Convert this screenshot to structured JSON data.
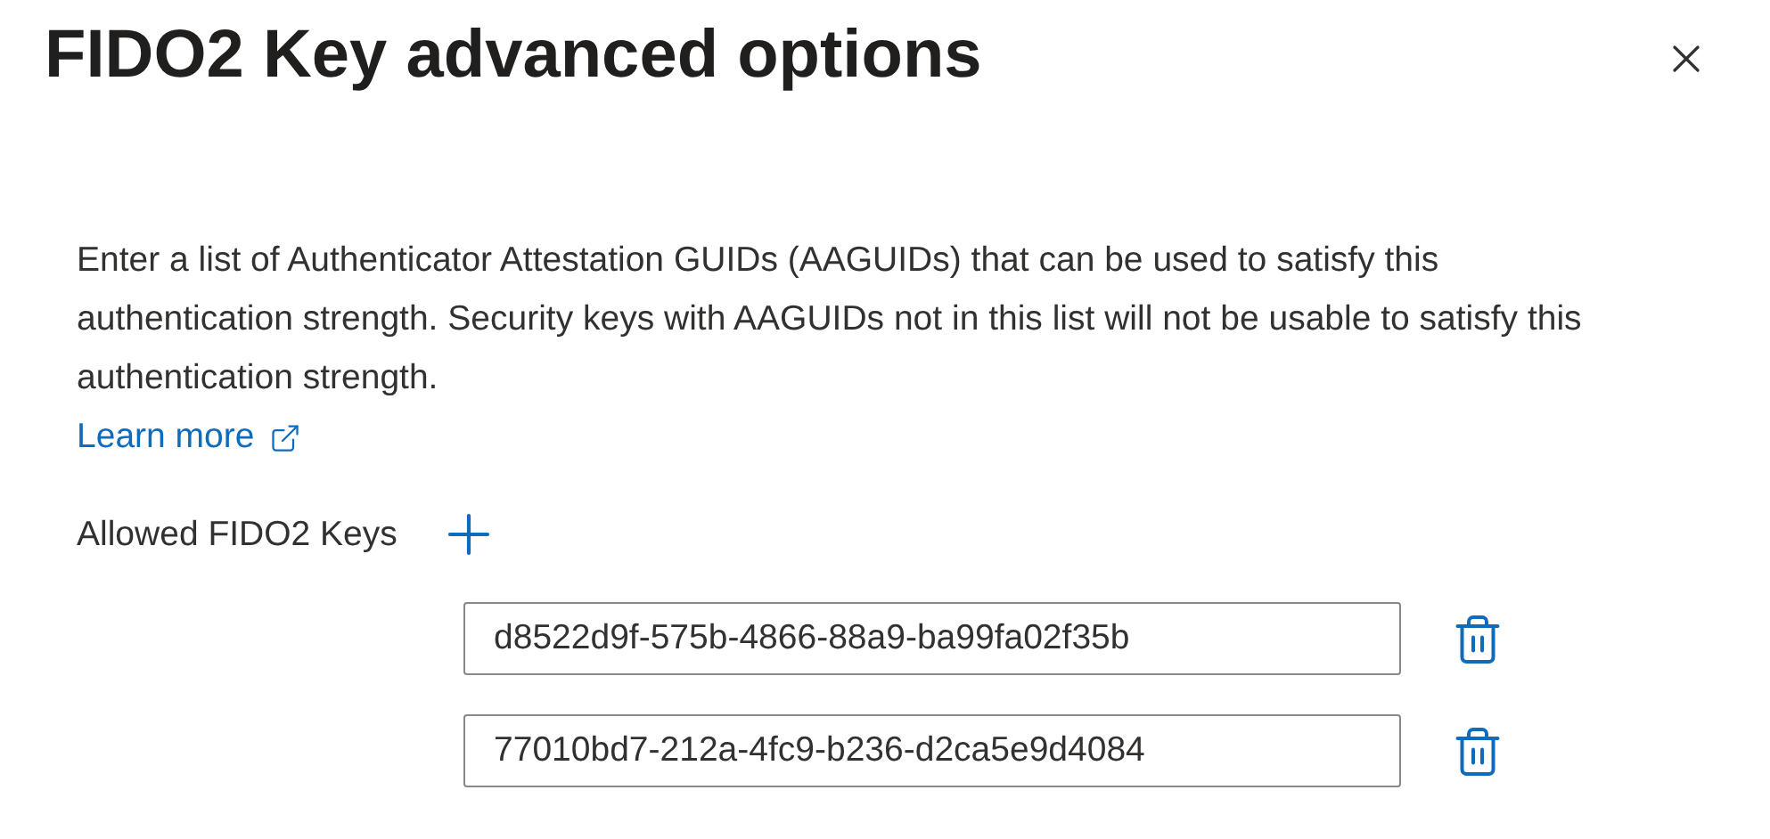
{
  "dialog": {
    "title": "FIDO2 Key advanced options"
  },
  "description": "Enter a list of Authenticator Attestation GUIDs (AAGUIDs) that can be used to satisfy this authentication strength. Security keys with AAGUIDs not in this list will not be usable to satisfy this authentication strength.",
  "learn_more": "Learn more",
  "allowed_keys": {
    "label": "Allowed FIDO2 Keys",
    "items": [
      {
        "value": "d8522d9f-575b-4866-88a9-ba99fa02f35b"
      },
      {
        "value": "77010bd7-212a-4fc9-b236-d2ca5e9d4084"
      }
    ]
  }
}
